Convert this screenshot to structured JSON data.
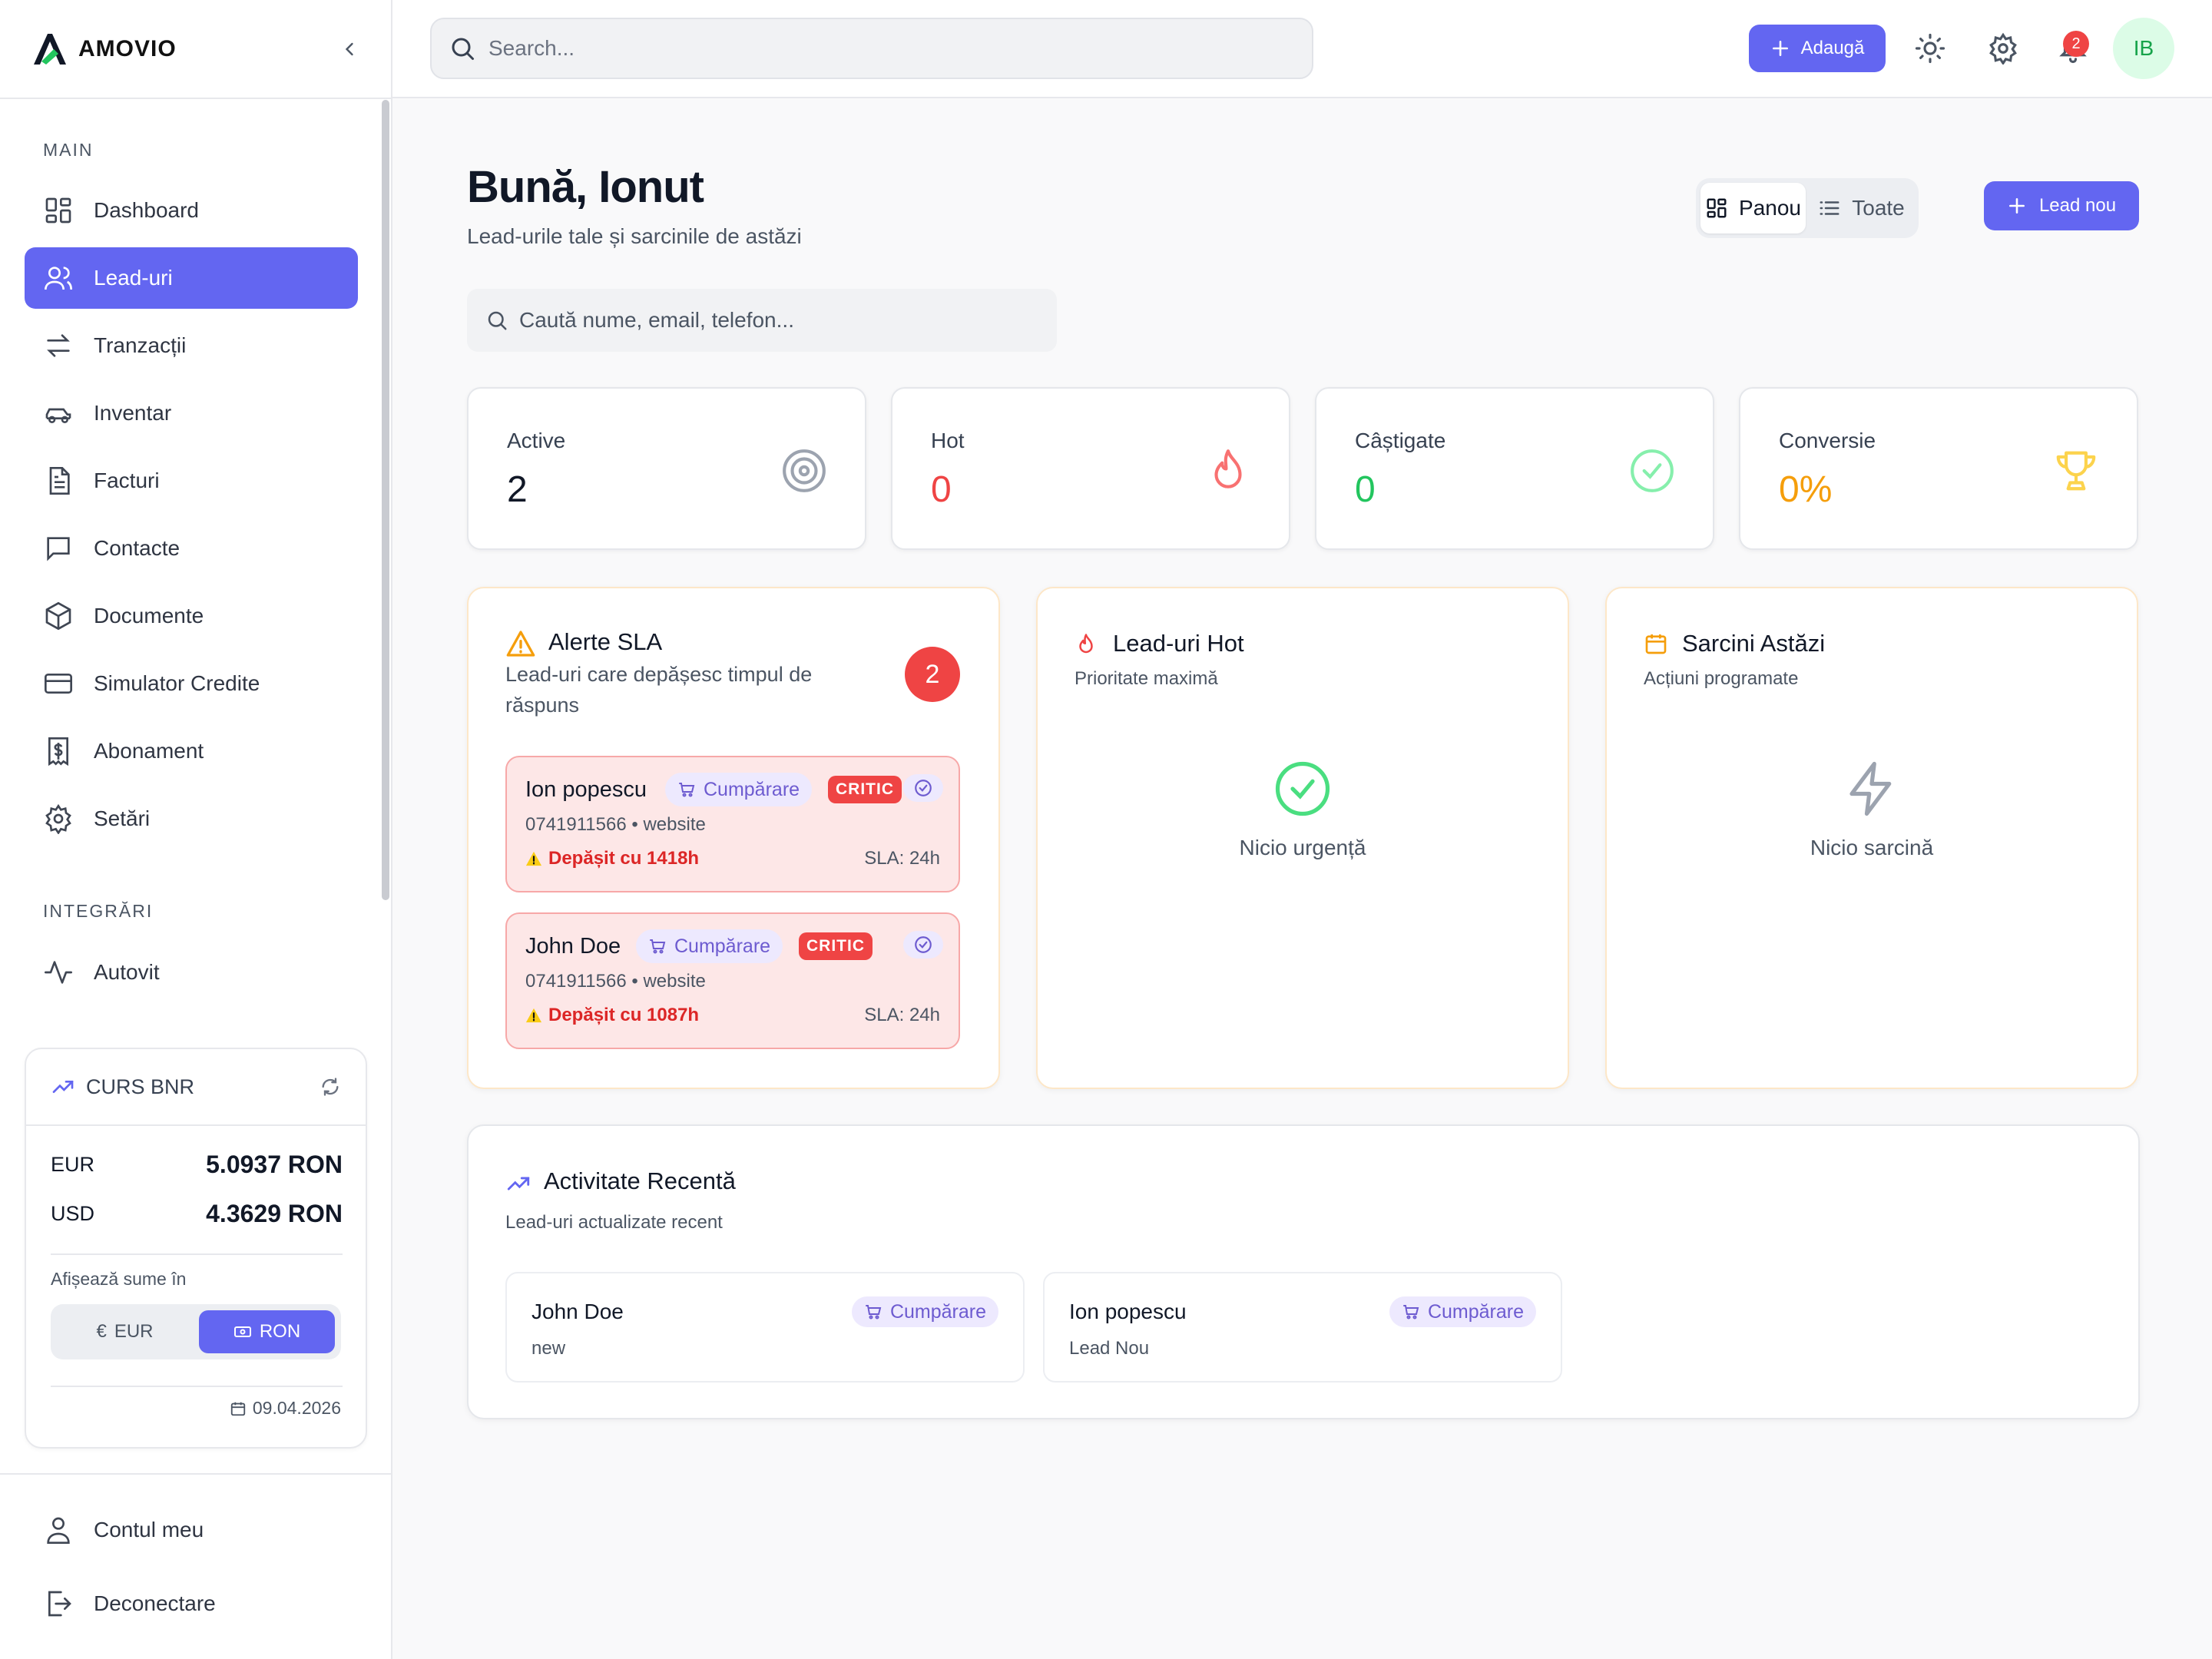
{
  "brand": {
    "name": "AMOVIO",
    "accent": "#6366f1"
  },
  "sidebar": {
    "section_main": "MAIN",
    "items": [
      {
        "label": "Dashboard",
        "icon": "layout-grid-icon"
      },
      {
        "label": "Lead-uri",
        "icon": "users-icon",
        "active": true
      },
      {
        "label": "Tranzacții",
        "icon": "arrows-swap-icon"
      },
      {
        "label": "Inventar",
        "icon": "car-icon"
      },
      {
        "label": "Facturi",
        "icon": "file-text-icon"
      },
      {
        "label": "Contacte",
        "icon": "message-square-icon"
      },
      {
        "label": "Documente",
        "icon": "box-icon"
      },
      {
        "label": "Simulator Credite",
        "icon": "credit-card-icon"
      },
      {
        "label": "Abonament",
        "icon": "receipt-dollar-icon"
      },
      {
        "label": "Setări",
        "icon": "gear-icon"
      }
    ],
    "section_integrations": "INTEGRĂRI",
    "integrations": [
      {
        "label": "Autovit",
        "icon": "activity-icon"
      }
    ],
    "curs": {
      "title": "CURS BNR",
      "rates": [
        {
          "currency": "EUR",
          "value": "5.0937 RON"
        },
        {
          "currency": "USD",
          "value": "4.3629 RON"
        }
      ],
      "note": "Afișează sume în",
      "toggle": [
        {
          "label": "EUR",
          "symbol": "€"
        },
        {
          "label": "RON",
          "active": true
        }
      ],
      "date": "09.04.2026"
    },
    "footer": [
      {
        "label": "Contul meu",
        "icon": "user-icon"
      },
      {
        "label": "Deconectare",
        "icon": "logout-icon"
      }
    ]
  },
  "topbar": {
    "search_placeholder": "Search...",
    "add_label": "Adaugă",
    "notifications": "2",
    "avatar": "IB"
  },
  "main": {
    "greeting": "Bună, Ionut",
    "subtitle": "Lead-urile tale și sarcinile de astăzi",
    "view_switch": [
      {
        "label": "Panou",
        "active": true
      },
      {
        "label": "Toate"
      }
    ],
    "new_lead_label": "Lead nou",
    "lead_search_placeholder": "Caută nume, email, telefon...",
    "stats": [
      {
        "label": "Active",
        "value": "2",
        "color": "#111827",
        "icon": "target-icon"
      },
      {
        "label": "Hot",
        "value": "0",
        "color": "#ef4444",
        "icon": "flame-icon"
      },
      {
        "label": "Câștigate",
        "value": "0",
        "color": "#22c55e",
        "icon": "check-circle-icon"
      },
      {
        "label": "Conversie",
        "value": "0%",
        "color": "#f59e0b",
        "icon": "trophy-icon"
      }
    ],
    "sla": {
      "title": "Alerte SLA",
      "subtitle": "Lead-uri care depășesc timpul de răspuns",
      "count": "2",
      "alerts": [
        {
          "name": "Ion popescu",
          "tag": "Cumpărare",
          "level": "CRITIC",
          "phone": "0741911566",
          "source": "website",
          "overdue": "Depășit cu 1418h",
          "sla": "SLA: 24h"
        },
        {
          "name": "John Doe",
          "tag": "Cumpărare",
          "level": "CRITIC",
          "phone": "0741911566",
          "source": "website",
          "overdue": "Depășit cu 1087h",
          "sla": "SLA: 24h"
        }
      ]
    },
    "hot": {
      "title": "Lead-uri Hot",
      "subtitle": "Prioritate maximă",
      "empty": "Nicio urgență"
    },
    "tasks": {
      "title": "Sarcini Astăzi",
      "subtitle": "Acțiuni programate",
      "empty": "Nicio sarcină"
    },
    "activity": {
      "title": "Activitate Recentă",
      "subtitle": "Lead-uri actualizate recent",
      "items": [
        {
          "name": "John Doe",
          "status": "new",
          "tag": "Cumpărare"
        },
        {
          "name": "Ion popescu",
          "status": "Lead Nou",
          "tag": "Cumpărare"
        }
      ]
    }
  }
}
